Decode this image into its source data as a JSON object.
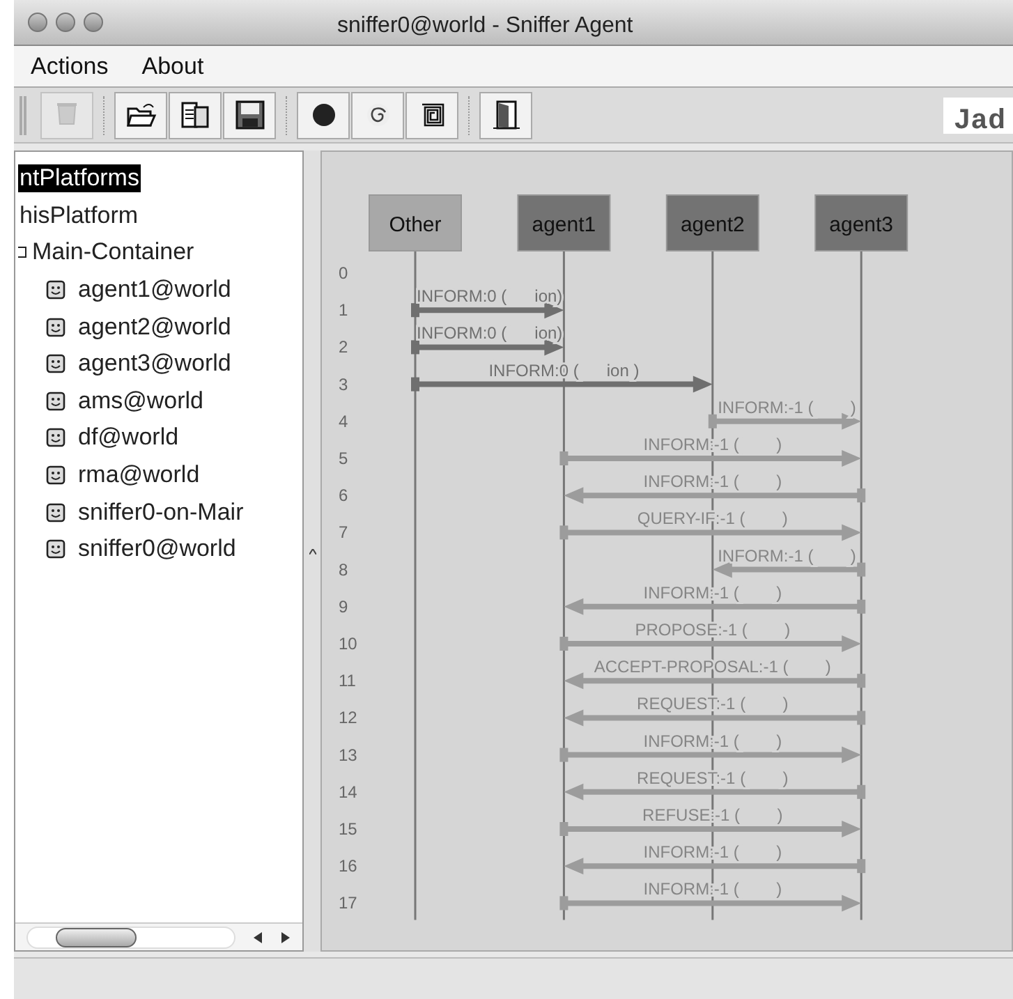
{
  "window": {
    "title": "sniffer0@world - Sniffer Agent"
  },
  "menu": [
    "Actions",
    "About"
  ],
  "toolbar": {
    "buttons": [
      {
        "kind": "trash",
        "disabled": true
      },
      {
        "kind": "open",
        "disabled": false
      },
      {
        "kind": "saveas",
        "disabled": false
      },
      {
        "kind": "save",
        "disabled": false
      },
      {
        "kind": "dot",
        "disabled": false
      },
      {
        "kind": "spiral",
        "disabled": false
      },
      {
        "kind": "square",
        "disabled": false
      },
      {
        "kind": "door",
        "disabled": false
      }
    ],
    "logo_text": "Jad"
  },
  "tree": [
    {
      "label": "ntPlatforms",
      "selected": true,
      "children": [
        {
          "label": "hisPlatform",
          "selected": false,
          "children": [
            {
              "label": "Main-Container",
              "selected": false,
              "children": [
                {
                  "label": "agent1@world",
                  "selected": false
                },
                {
                  "label": "agent2@world",
                  "selected": false
                },
                {
                  "label": "agent3@world",
                  "selected": false
                },
                {
                  "label": "ams@world",
                  "selected": false
                },
                {
                  "label": "df@world",
                  "selected": false
                },
                {
                  "label": "rma@world",
                  "selected": false
                },
                {
                  "label": "sniffer0-on-Mair",
                  "selected": false
                },
                {
                  "label": "sniffer0@world",
                  "selected": false
                }
              ]
            }
          ]
        }
      ]
    }
  ],
  "diagram": {
    "agents": [
      {
        "name": "Other",
        "kind": "other"
      },
      {
        "name": "agent1",
        "kind": "agent"
      },
      {
        "name": "agent2",
        "kind": "agent"
      },
      {
        "name": "agent3",
        "kind": "agent"
      }
    ],
    "rows": [
      {
        "number": "0"
      },
      {
        "number": "1",
        "message": {
          "kind": "other-agent1",
          "label": "INFORM:0 (      ion)",
          "highlighted": true
        }
      },
      {
        "number": "2",
        "message": {
          "kind": "other-agent1",
          "label": "INFORM:0 (      ion)",
          "highlighted": true
        }
      },
      {
        "number": "3",
        "message": {
          "kind": "other-agent2",
          "label": "INFORM:0 (      ion )",
          "highlighted": true
        }
      },
      {
        "number": "4",
        "message": {
          "kind": "agent2-agent3",
          "label": "INFORM:-1 (        )",
          "highlighted": false
        }
      },
      {
        "number": "5",
        "message": {
          "kind": "agent1-agent3",
          "label": "INFORM:-1 (        )",
          "highlighted": false
        }
      },
      {
        "number": "6",
        "message": {
          "kind": "agent3-agent1",
          "label": "INFORM:-1 (        )",
          "highlighted": false
        }
      },
      {
        "number": "7",
        "message": {
          "kind": "agent1-agent3",
          "label": "QUERY-IF:-1 (        )",
          "highlighted": false
        }
      },
      {
        "number": "8",
        "message": {
          "kind": "agent3-agent2",
          "label": "INFORM:-1 (        )",
          "highlighted": false
        }
      },
      {
        "number": "9",
        "message": {
          "kind": "agent3-agent1",
          "label": "INFORM:-1 (        )",
          "highlighted": false
        }
      },
      {
        "number": "10",
        "message": {
          "kind": "agent1-agent3",
          "label": "PROPOSE:-1 (        )",
          "highlighted": false
        }
      },
      {
        "number": "11",
        "message": {
          "kind": "agent3-agent1",
          "label": "ACCEPT-PROPOSAL:-1 (        )",
          "highlighted": false
        }
      },
      {
        "number": "12",
        "message": {
          "kind": "agent3-agent1",
          "label": "REQUEST:-1 (        )",
          "highlighted": false
        }
      },
      {
        "number": "13",
        "message": {
          "kind": "agent1-agent3",
          "label": "INFORM:-1 (        )",
          "highlighted": false
        }
      },
      {
        "number": "14",
        "message": {
          "kind": "agent3-agent1",
          "label": "REQUEST:-1 (        )",
          "highlighted": false
        }
      },
      {
        "number": "15",
        "message": {
          "kind": "agent1-agent3",
          "label": "REFUSE:-1 (        )",
          "highlighted": false
        }
      },
      {
        "number": "16",
        "message": {
          "kind": "agent3-agent1",
          "label": "INFORM:-1 (        )",
          "highlighted": false
        }
      },
      {
        "number": "17",
        "message": {
          "kind": "agent1-agent3",
          "label": "INFORM:-1 (        )",
          "highlighted": false
        }
      }
    ]
  }
}
